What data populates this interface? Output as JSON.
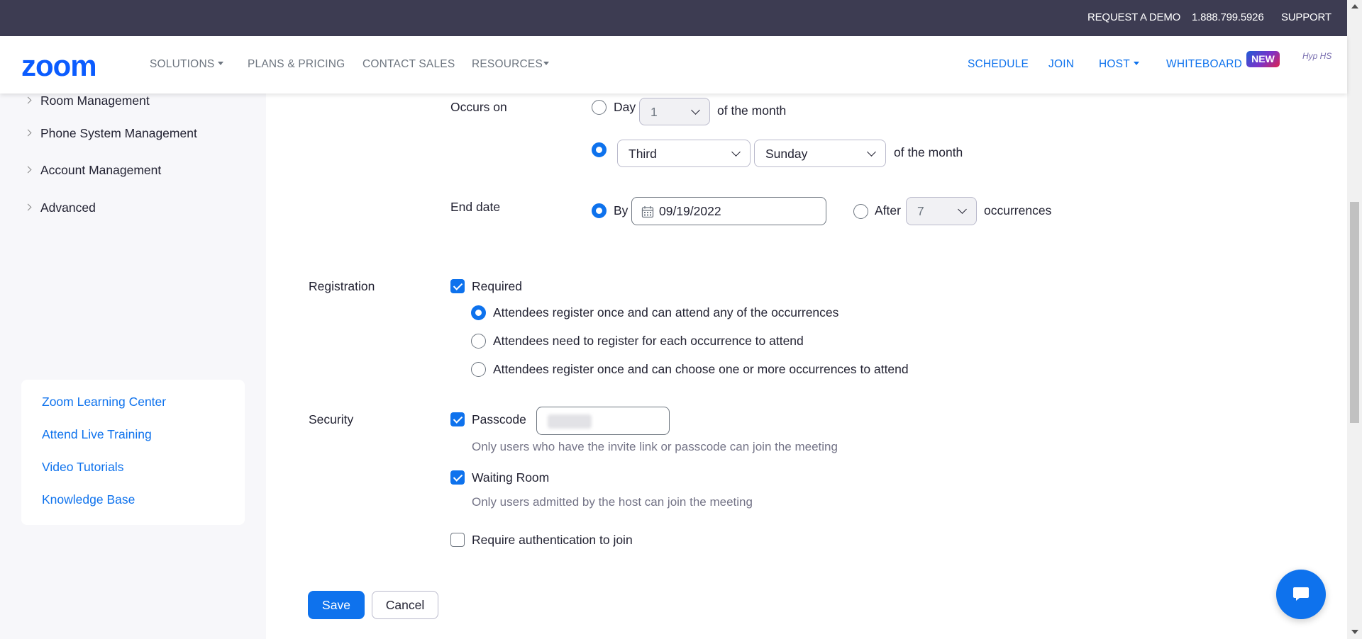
{
  "topbar": {
    "request_demo": "REQUEST A DEMO",
    "phone": "1.888.799.5926",
    "support": "SUPPORT"
  },
  "nav": {
    "logo": "zoom",
    "solutions": "SOLUTIONS",
    "plans_pricing": "PLANS & PRICING",
    "contact_sales": "CONTACT SALES",
    "resources": "RESOURCES",
    "schedule": "SCHEDULE",
    "join": "JOIN",
    "host": "HOST",
    "whiteboard": "WHITEBOARD",
    "new_badge": "NEW",
    "avatar_text": "Hyp HS"
  },
  "sidebar": {
    "items": [
      {
        "label": "Room Management"
      },
      {
        "label": "Phone System Management"
      },
      {
        "label": "Account Management"
      },
      {
        "label": "Advanced"
      }
    ],
    "help_links": [
      {
        "label": "Zoom Learning Center"
      },
      {
        "label": "Attend Live Training"
      },
      {
        "label": "Video Tutorials"
      },
      {
        "label": "Knowledge Base"
      }
    ]
  },
  "recurrence": {
    "occurs_on_label": "Occurs on",
    "day_label": "Day",
    "day_value": "1",
    "of_month_1": "of the month",
    "week_value": "Third",
    "weekday_value": "Sunday",
    "of_month_2": "of the month",
    "end_date_label": "End date",
    "by_label": "By",
    "by_date": "09/19/2022",
    "after_label": "After",
    "after_value": "7",
    "occurrences_label": "occurrences",
    "occurs_on_day_selected": false,
    "occurs_on_week_selected": true,
    "end_by_selected": true,
    "end_after_selected": false
  },
  "registration": {
    "label": "Registration",
    "required_label": "Required",
    "required_checked": true,
    "options": [
      {
        "label": "Attendees register once and can attend any of the occurrences",
        "selected": true
      },
      {
        "label": "Attendees need to register for each occurrence to attend",
        "selected": false
      },
      {
        "label": "Attendees register once and can choose one or more occurrences to attend",
        "selected": false
      }
    ]
  },
  "security": {
    "label": "Security",
    "passcode_label": "Passcode",
    "passcode_checked": true,
    "passcode_hint": "Only users who have the invite link or passcode can join the meeting",
    "waiting_room_label": "Waiting Room",
    "waiting_room_checked": true,
    "waiting_room_hint": "Only users admitted by the host can join the meeting",
    "auth_label": "Require authentication to join",
    "auth_checked": false
  },
  "actions": {
    "save": "Save",
    "cancel": "Cancel"
  },
  "colors": {
    "brand": "#0b5cff",
    "accent": "#0e72ed",
    "topbar_bg": "#3d3c52",
    "sidebar_bg": "#f7f7fa"
  }
}
